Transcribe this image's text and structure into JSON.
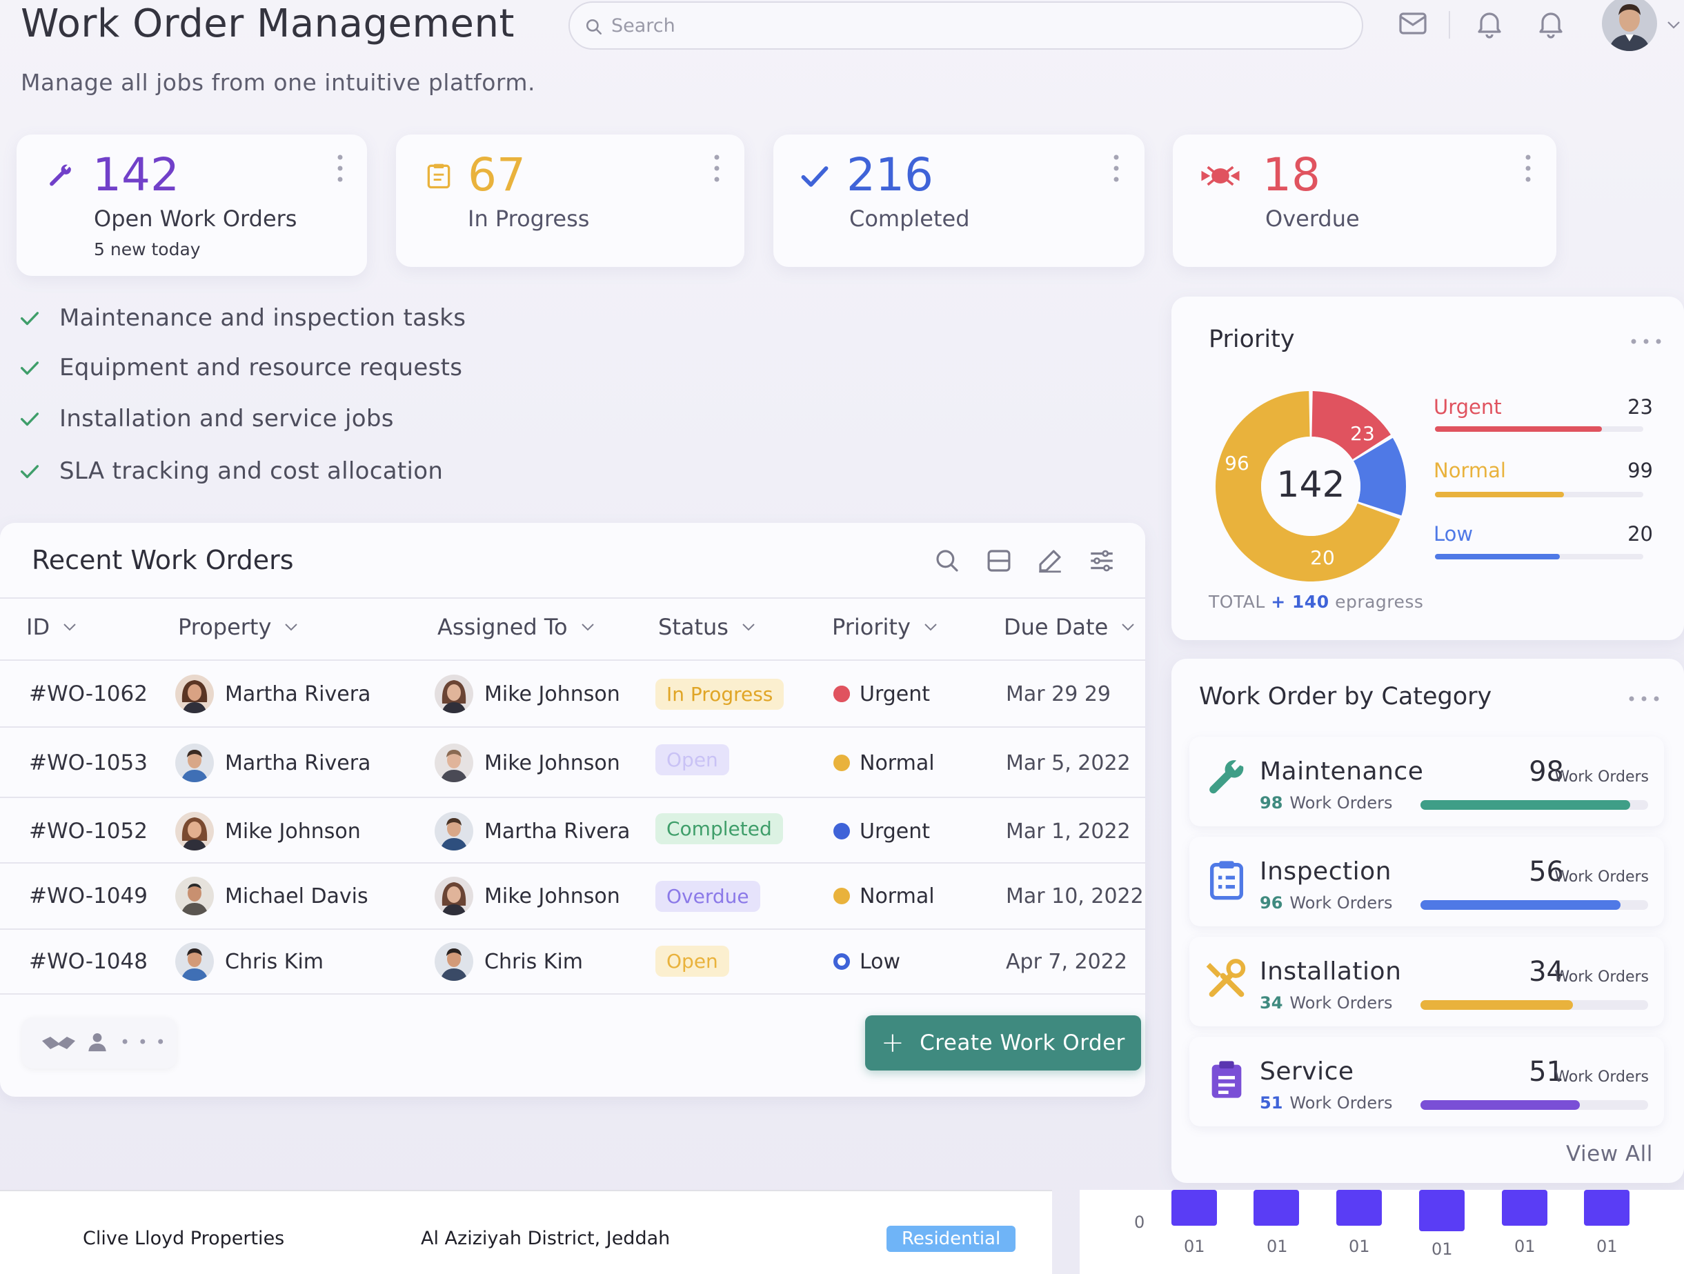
{
  "header": {
    "title": "Work Order Management",
    "subtitle": "Manage all jobs from one intuitive platform.",
    "search_placeholder": "Search"
  },
  "stats": [
    {
      "value": "142",
      "label": "Open Work Orders",
      "sub": "5 new today",
      "color": "#7140c9",
      "icon": "wrench-icon"
    },
    {
      "value": "67",
      "label": "In Progress",
      "color": "#e9b23c",
      "icon": "clipboard-icon"
    },
    {
      "value": "216",
      "label": "Completed",
      "color": "#3f63d8",
      "icon": "check-icon"
    },
    {
      "value": "18",
      "label": "Overdue",
      "color": "#e0535f",
      "icon": "alert-icon"
    }
  ],
  "features": [
    "Maintenance and inspection tasks",
    "Equipment and resource requests",
    "Installation and service jobs",
    "SLA tracking and cost allocation"
  ],
  "table": {
    "title": "Recent Work Orders",
    "columns": [
      "ID",
      "Property",
      "Assigned To",
      "Status",
      "Priority",
      "Due Date"
    ],
    "rows": [
      {
        "id": "#WO-1062",
        "property": "Martha Rivera",
        "assigned": "Mike Johnson",
        "status": "In Progress",
        "priority": "Urgent",
        "due": "Mar 29 29"
      },
      {
        "id": "#WO-1053",
        "property": "Martha Rivera",
        "assigned": "Mike Johnson",
        "status": "Open",
        "priority": "Normal",
        "due": "Mar 5, 2022"
      },
      {
        "id": "#WO-1052",
        "property": "Mike Johnson",
        "assigned": "Martha Rivera",
        "status": "Completed",
        "priority": "Urgent",
        "due": "Mar 1, 2022"
      },
      {
        "id": "#WO-1049",
        "property": "Michael Davis",
        "assigned": "Mike Johnson",
        "status": "Overdue",
        "priority": "Normal",
        "due": "Mar 10, 2022"
      },
      {
        "id": "#WO-1048",
        "property": "Chris Kim",
        "assigned": "Chris Kim",
        "status": "Open",
        "priority": "Low",
        "due": "Apr 7, 2022"
      }
    ],
    "create_button": "Create Work Order",
    "more_glyph": "• • •"
  },
  "priority": {
    "title": "Priority",
    "total": "142",
    "segments": [
      {
        "name": "Urgent",
        "value": 23,
        "color": "#e0535f"
      },
      {
        "name": "Normal",
        "value": 99,
        "color": "#e9b23c"
      },
      {
        "name": "Low",
        "value": 20,
        "color": "#4f79e6"
      }
    ],
    "donut_labels": {
      "urgent": "23",
      "normal": "96",
      "low": "20"
    },
    "legend": [
      {
        "label": "Urgent",
        "value": "23",
        "color": "#e0535f",
        "fill": 0.8
      },
      {
        "label": "Normal",
        "value": "99",
        "color": "#e9b23c",
        "fill": 0.62
      },
      {
        "label": "Low",
        "value": "20",
        "color": "#4f79e6",
        "fill": 0.6
      }
    ],
    "total_prefix": "TOTAL",
    "total_accent": "+ 140",
    "total_suffix": "epragress"
  },
  "categories": {
    "title": "Work Order by Category",
    "view_all": "View All",
    "items": [
      {
        "name": "Maintenance",
        "count": "98",
        "unit": "Work Orders",
        "sub_count": "98",
        "sub_unit": "Work Orders",
        "color": "#3f9e87",
        "fill": 0.92,
        "icon": "wrench-icon"
      },
      {
        "name": "Inspection",
        "count": "56",
        "unit": "Work Orders",
        "sub_count": "96",
        "sub_unit": "Work Orders",
        "color": "#4f79e6",
        "fill": 0.88,
        "icon": "clipboard-list-icon"
      },
      {
        "name": "Installation",
        "count": "34",
        "unit": "Work Orders",
        "sub_count": "34",
        "sub_unit": "Work Orders",
        "color": "#e9b23c",
        "fill": 0.67,
        "icon": "tools-icon"
      },
      {
        "name": "Service",
        "count": "51",
        "unit": "Work Orders",
        "sub_count": "51",
        "sub_unit": "Work Orders",
        "color": "#7a4fd6",
        "fill": 0.7,
        "icon": "clipboard-icon"
      }
    ]
  },
  "bottom": {
    "company": "Clive Lloyd Properties",
    "location": "Al Aziziyah District, Jeddah",
    "tag": "Residential",
    "zero": "0",
    "ticks": [
      "01",
      "01",
      "01",
      "01",
      "01",
      "01"
    ]
  },
  "colors": {
    "accent_teal": "#3f8a7f",
    "urgent": "#e0535f",
    "normal": "#e9b23c",
    "low": "#3f63d8",
    "bar": "#5a3df5"
  }
}
